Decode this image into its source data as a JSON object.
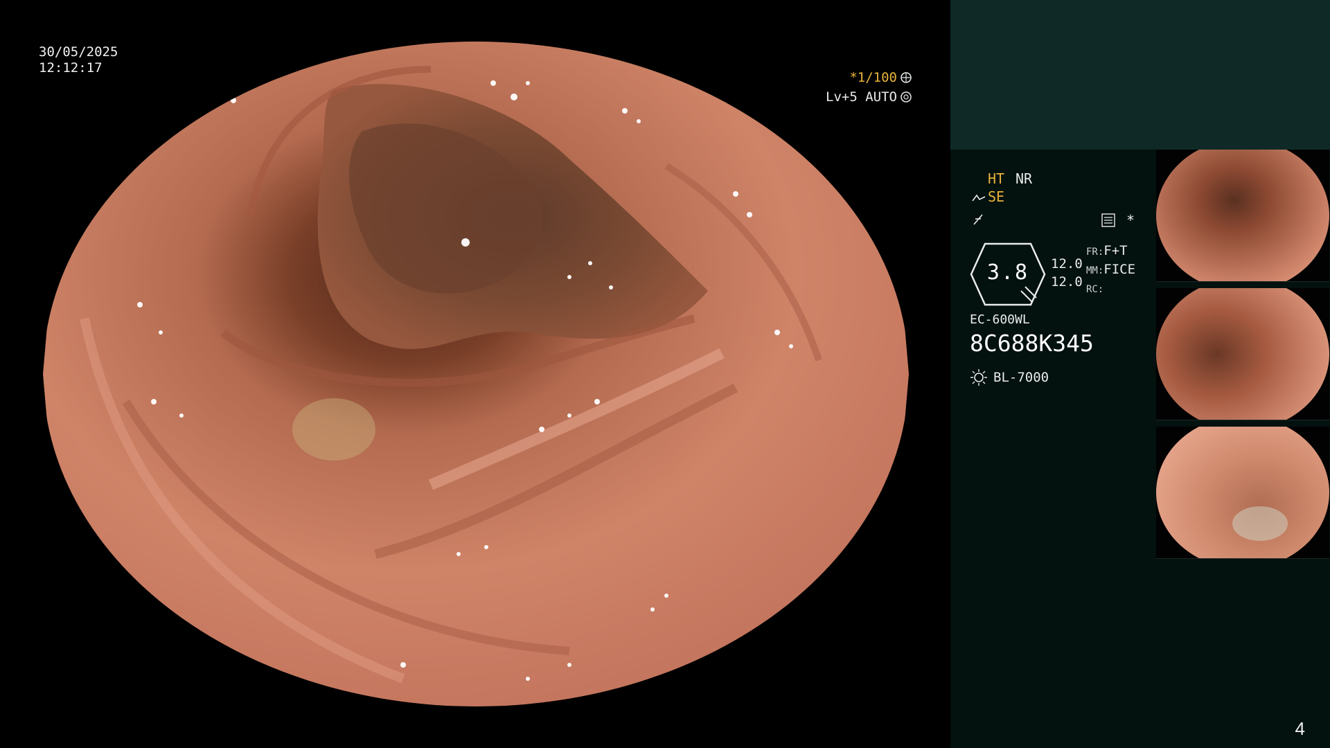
{
  "overlay": {
    "date": "30/05/2025",
    "time": "12:12:17",
    "shutter": "*1/100",
    "level": "Lv+5 AUTO"
  },
  "panel": {
    "ht": "HT",
    "nr": "NR",
    "se": "SE",
    "gauge_value": "3.8",
    "fr_label": "FR:",
    "fr_value": "F+T",
    "mm_label": "MM:",
    "mm_value": "FICE",
    "rc_label": "RC:",
    "val_a": "12.0",
    "val_b": "12.0",
    "scope_model": "EC-600WL",
    "serial": "8C688K345",
    "light_source": "BL-7000",
    "asterisk": "*"
  },
  "page_number": "4",
  "colors": {
    "amber": "#e8b33a",
    "panel_bg": "#03110f",
    "panel_top_bg": "#0f2a26",
    "tissue": "#c97a62"
  },
  "thumbnails": [
    {
      "name": "thumbnail-1"
    },
    {
      "name": "thumbnail-2"
    },
    {
      "name": "thumbnail-3"
    }
  ]
}
